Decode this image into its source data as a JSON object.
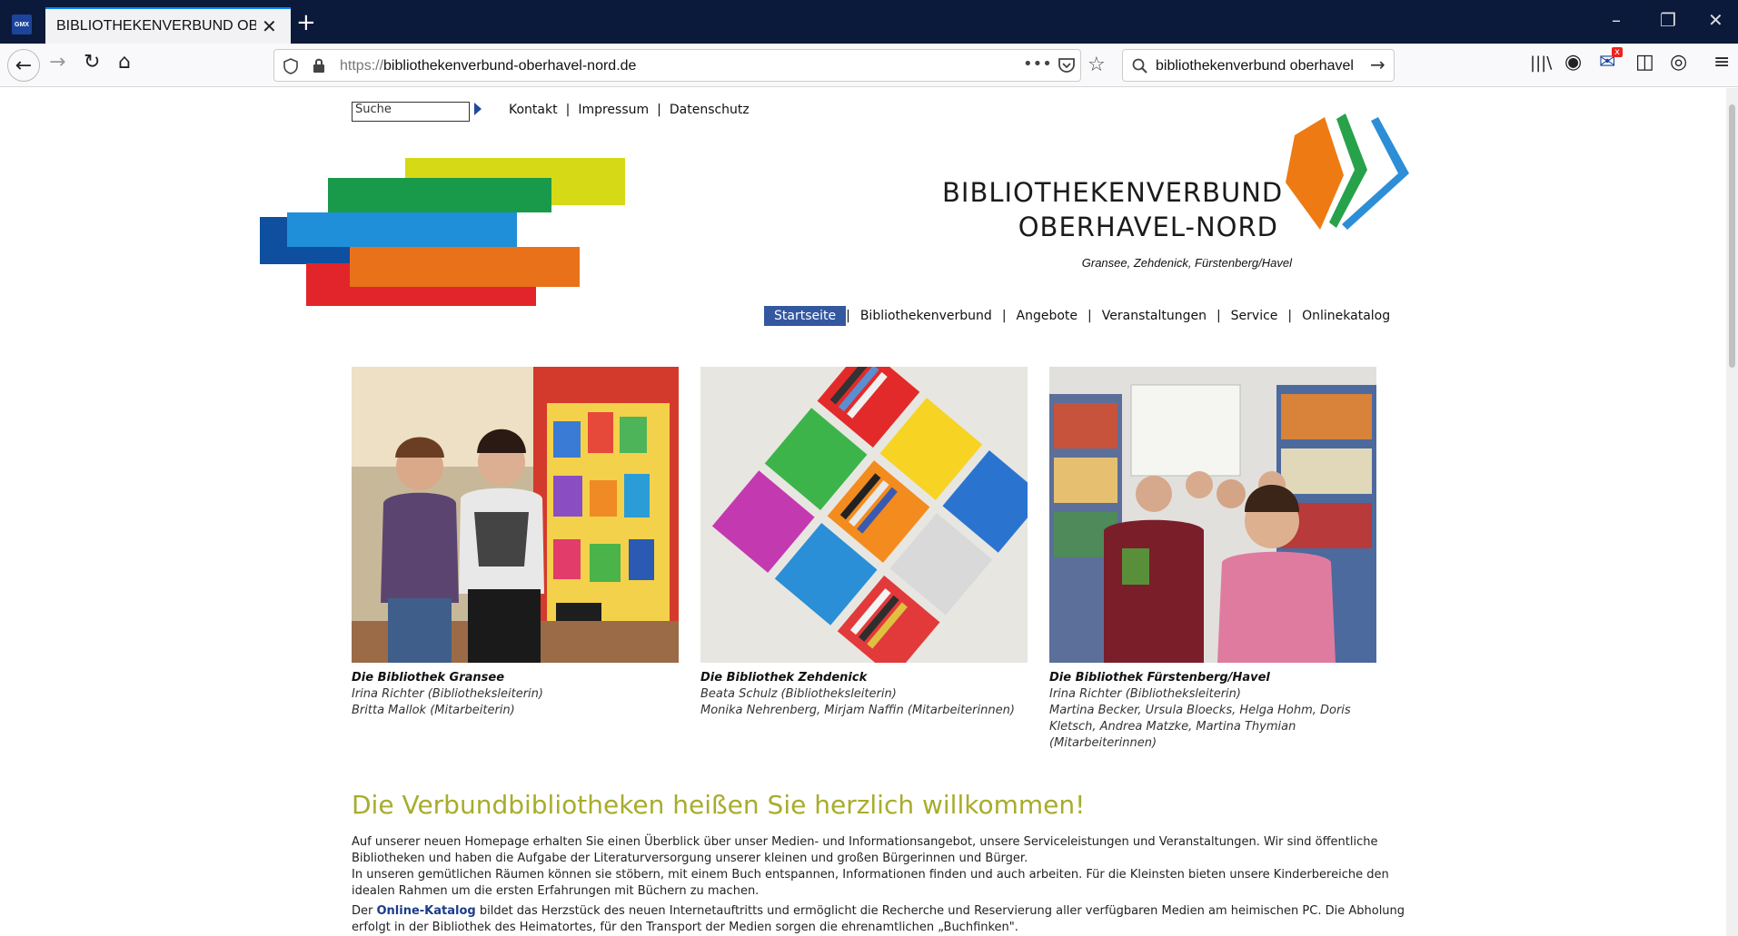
{
  "browser": {
    "tab_title": "BIBLIOTHEKENVERBUND OBERHAVEL-NORD",
    "tab_close": "✕",
    "new_tab": "+",
    "favicon_label": "GMX",
    "url_protocol": "https://",
    "url_host": "bibliothekenverbund-oberhavel-nord.de",
    "search_text": "bibliothekenverbund oberhavel",
    "controls": {
      "minimize": "–",
      "restore": "❐",
      "close": "✕"
    }
  },
  "site": {
    "search_value": "Suche",
    "toplinks": [
      "Kontakt",
      "Impressum",
      "Datenschutz"
    ],
    "brand_line1": "BIBLIOTHEKENVERBUND",
    "brand_line2": "OBERHAVEL-NORD",
    "brand_sub": "Gransee, Zehdenick, Fürstenberg/Havel",
    "logo_colors": [
      "#d6d916",
      "#199a4a",
      "#0f4fa0",
      "#1e8fd8",
      "#e8711a",
      "#e2252a"
    ],
    "book_colors": [
      "#ee7a14",
      "#27a24a",
      "#2c8ed6"
    ],
    "nav": [
      "Startseite",
      "Bibliothekenverbund",
      "Angebote",
      "Veranstaltungen",
      "Service",
      "Onlinekatalog"
    ],
    "active_nav": "Startseite",
    "libraries": [
      {
        "title": "Die Bibliothek Gransee",
        "lines": [
          "Irina Richter (Bibliotheksleiterin)",
          "Britta Mallok (Mitarbeiterin)"
        ]
      },
      {
        "title": "Die Bibliothek Zehdenick",
        "lines": [
          "Beata Schulz (Bibliotheksleiterin)",
          "Monika Nehrenberg, Mirjam Naffin (Mitarbeiterinnen)"
        ]
      },
      {
        "title": "Die Bibliothek Fürstenberg/Havel",
        "lines": [
          "Irina Richter (Bibliotheksleiterin)",
          "Martina Becker, Ursula Bloecks, Helga Hohm, Doris Kletsch, Andrea Matzke, Martina Thymian (Mitarbeiterinnen)"
        ]
      }
    ],
    "welcome_title": "Die Verbundbibliotheken heißen Sie herzlich willkommen!",
    "intro_p1": "Auf unserer neuen Homepage erhalten Sie einen Überblick über unser Medien- und Informationsangebot, unsere Serviceleistungen und Veranstaltungen. Wir sind öffentliche Bibliotheken und haben die Aufgabe der Literaturversorgung unserer kleinen und großen Bürgerinnen und Bürger.",
    "intro_p2": "In unseren gemütlichen Räumen können sie stöbern, mit einem Buch entspannen, Informationen finden und auch arbeiten. Für die Kleinsten bieten unsere Kinderbereiche den idealen Rahmen um die ersten Erfahrungen mit Büchern zu machen.",
    "intro_p3_before": "Der ",
    "intro_p3_link": "Online-Katalog",
    "intro_p3_after": " bildet das Herzstück des neuen Internetauftritts und ermöglicht die Recherche und Reservierung aller verfügbaren Medien am heimischen PC. Die Abholung erfolgt in der Bibliothek des Heimatortes, für den Transport der Medien sorgen die ehrenamtlichen „Buchfinken\"."
  }
}
